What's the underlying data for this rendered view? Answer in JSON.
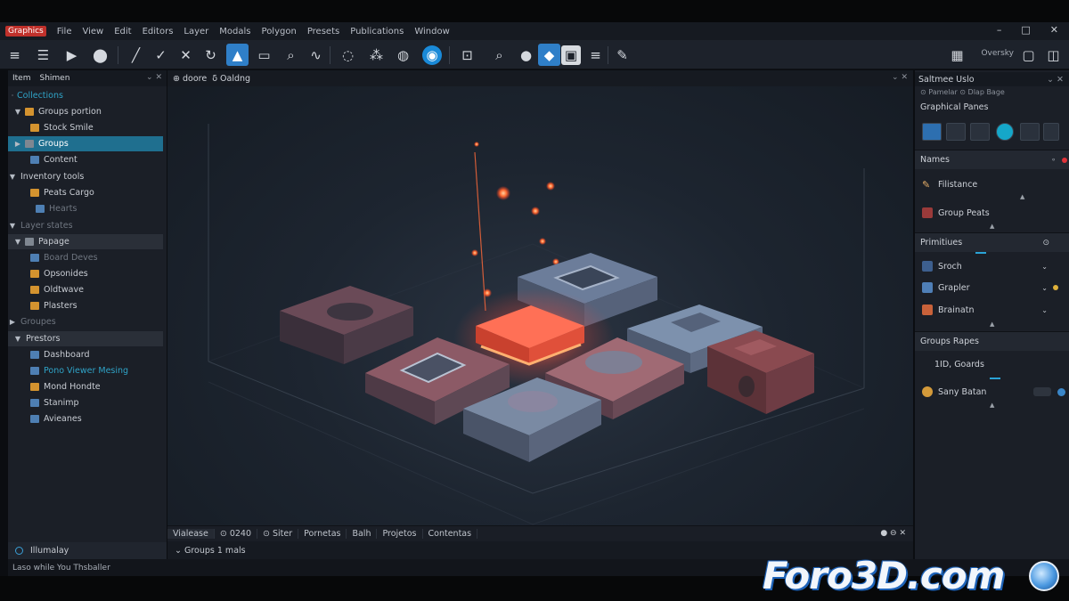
{
  "menubar": {
    "app_tag": "Graphics",
    "items": [
      "File",
      "View",
      "Edit",
      "Editors",
      "Layer",
      "Modals",
      "Polygon",
      "Presets",
      "Publications",
      "Window"
    ]
  },
  "window_controls": {
    "minimize": "–",
    "maximize": "□",
    "close": "✕"
  },
  "toolbar": {
    "right_label": "Oversky",
    "tools": [
      "menu-icon",
      "list-icon",
      "play-icon",
      "pin-icon",
      "line-icon",
      "check-icon",
      "cross-icon",
      "rotate-icon",
      "paint-icon",
      "screen-icon",
      "search-icon",
      "wave-icon",
      "lasso-icon",
      "scatter-icon",
      "bucket-icon",
      "globe-icon",
      "frame-icon",
      "zoom-icon",
      "dot-icon",
      "select-icon",
      "image-icon",
      "hamburger-icon",
      "brush-icon"
    ]
  },
  "left_panel": {
    "tabs": [
      "Item",
      "Shimen"
    ],
    "controls": "⌄ ✕",
    "header": "Collections",
    "rows": [
      {
        "label": "Groups portion",
        "twisty": "▼",
        "icon": "folder",
        "indent": 1,
        "style": ""
      },
      {
        "label": "Stock Smile",
        "twisty": "",
        "icon": "folder",
        "indent": 2,
        "style": ""
      },
      {
        "label": "Groups",
        "twisty": "▶",
        "icon": "grey",
        "indent": 1,
        "style": "sel"
      },
      {
        "label": "Content",
        "twisty": "",
        "icon": "blue",
        "indent": 2,
        "style": ""
      },
      {
        "label": "Inventory tools",
        "twisty": "▼",
        "icon": "",
        "indent": 0,
        "style": ""
      },
      {
        "label": "Peats Cargo",
        "twisty": "",
        "icon": "folder",
        "indent": 2,
        "style": ""
      },
      {
        "label": "Hearts",
        "twisty": "",
        "icon": "blue",
        "indent": 3,
        "style": "dim"
      },
      {
        "label": "Layer states",
        "twisty": "▼",
        "icon": "",
        "indent": 0,
        "style": "dim"
      },
      {
        "label": "Papage",
        "twisty": "▼",
        "icon": "grey",
        "indent": 1,
        "style": "hdr"
      },
      {
        "label": "Board Deves",
        "twisty": "",
        "icon": "blue",
        "indent": 2,
        "style": "dim"
      },
      {
        "label": "Opsonides",
        "twisty": "",
        "icon": "folder",
        "indent": 2,
        "style": ""
      },
      {
        "label": "Oldtwave",
        "twisty": "",
        "icon": "folder",
        "indent": 2,
        "style": ""
      },
      {
        "label": "Plasters",
        "twisty": "",
        "icon": "folder",
        "indent": 2,
        "style": ""
      },
      {
        "label": "Groupes",
        "twisty": "▶",
        "icon": "",
        "indent": 0,
        "style": "dim"
      },
      {
        "label": "Prestors",
        "twisty": "▼",
        "icon": "",
        "indent": 1,
        "style": "hdr"
      },
      {
        "label": "Dashboard",
        "twisty": "",
        "icon": "blue",
        "indent": 2,
        "style": ""
      },
      {
        "label": "Pono Viewer   Mesing",
        "twisty": "",
        "icon": "blue",
        "indent": 2,
        "style": "cyan"
      },
      {
        "label": "Mond Hondte",
        "twisty": "",
        "icon": "folder",
        "indent": 2,
        "style": ""
      },
      {
        "label": "Stanimp",
        "twisty": "",
        "icon": "blue",
        "indent": 2,
        "style": ""
      },
      {
        "label": "Avieanes",
        "twisty": "",
        "icon": "blue",
        "indent": 2,
        "style": ""
      }
    ],
    "footer_label": "Illumalay"
  },
  "viewport": {
    "tabs": [
      "⊕ doore",
      "δ Oaldng"
    ],
    "controls": "⌄ ✕"
  },
  "bottom_tabs": {
    "items": [
      "Vialease",
      "⊙ 0240",
      "⊙ Siter",
      "Pornetas",
      "Balh",
      "Projetos",
      "Contentas"
    ],
    "controls": "● ⊖ ✕"
  },
  "bottom_info": {
    "label": "⌄   Groups   1 mals"
  },
  "statusbar": {
    "text": "Laso while You Thsballer"
  },
  "right_panel": {
    "tabs": "Saltmee   Uslo",
    "sub_tabs": "⊙ Pamelar   ⊙ Dlap Bage",
    "subtitle": "Graphical Panes",
    "names_header": "Names",
    "names": [
      {
        "label": "Filistance",
        "icon": "brush"
      },
      {
        "label": "Group Peats",
        "icon": "red"
      }
    ],
    "primitives_header": "Primitiues",
    "primitives": [
      {
        "label": "Sroch",
        "icon": "blue"
      },
      {
        "label": "Grapler",
        "icon": "blue"
      },
      {
        "label": "Brainatn",
        "icon": "red"
      }
    ],
    "groups_header": "Groups Rapes",
    "groups": [
      {
        "label": "1ID, Goards",
        "icon": ""
      },
      {
        "label": "Sany Batan",
        "icon": "orange"
      }
    ]
  },
  "watermark": {
    "text": "Foro3D.com"
  },
  "colors": {
    "accent": "#2f7fc8",
    "selection": "#1f6f8f",
    "glow": "#ff5a3c",
    "app_red": "#c0312b"
  }
}
